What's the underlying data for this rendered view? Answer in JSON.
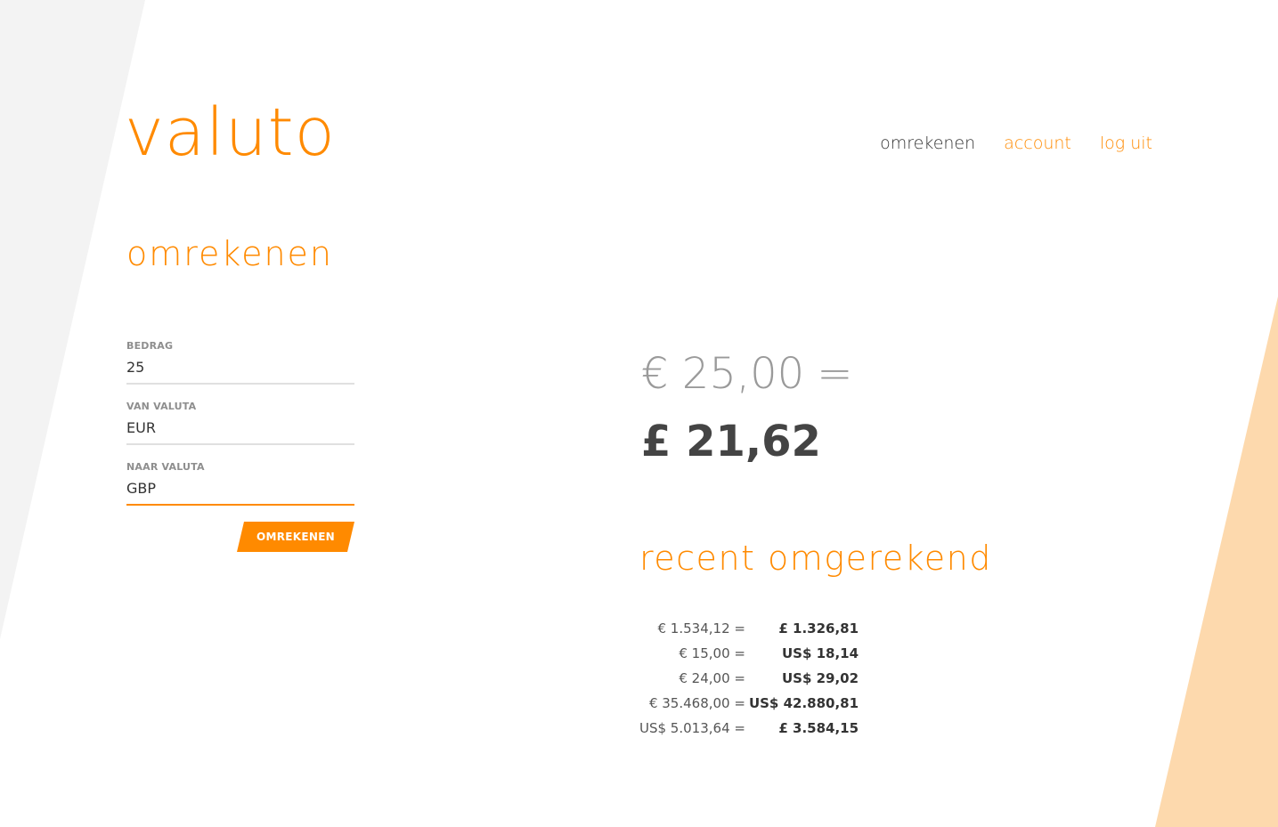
{
  "app": {
    "logo": "valuto"
  },
  "nav": {
    "items": [
      {
        "label": "omrekenen",
        "active": true
      },
      {
        "label": "account",
        "active": false
      },
      {
        "label": "log uit",
        "active": false
      }
    ]
  },
  "page": {
    "title": "omrekenen"
  },
  "form": {
    "amount": {
      "label": "BEDRAG",
      "value": "25"
    },
    "from_currency": {
      "label": "VAN VALUTA",
      "value": "EUR"
    },
    "to_currency": {
      "label": "NAAR VALUTA",
      "value": "GBP"
    },
    "submit_label": "OMREKENEN"
  },
  "result": {
    "from": "€ 25,00",
    "equals": "=",
    "to": "£ 21,62"
  },
  "recent": {
    "title": "recent omgerekend",
    "rows": [
      {
        "from": "€ 1.534,12 =",
        "to": "£ 1.326,81"
      },
      {
        "from": "€ 15,00 =",
        "to": "US$ 18,14"
      },
      {
        "from": "€ 24,00 =",
        "to": "US$ 29,02"
      },
      {
        "from": "€ 35.468,00 =",
        "to": "US$ 42.880,81"
      },
      {
        "from": "US$ 5.013,64 =",
        "to": "£ 3.584,15"
      }
    ]
  },
  "colors": {
    "accent": "#ff8a00",
    "accent_light": "#fdd9ad",
    "bg_shape": "#f3f3f3",
    "text_dark": "#444444",
    "text_muted": "#9a9a9a"
  }
}
